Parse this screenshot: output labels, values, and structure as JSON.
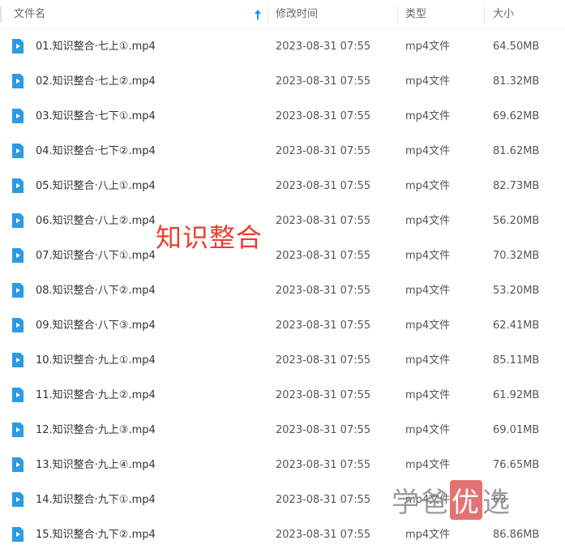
{
  "header": {
    "col_name": "文件名",
    "col_date": "修改时间",
    "col_type": "类型",
    "col_size": "大小"
  },
  "colors": {
    "accent": "#1e90ff",
    "file_icon": "#2b9be6",
    "overlay": "#e8402e",
    "watermark_highlight": "#e05a5a"
  },
  "files": [
    {
      "name": "01.知识整合·七上①.mp4",
      "date": "2023-08-31 07:55",
      "type": "mp4文件",
      "size": "64.50MB"
    },
    {
      "name": "02.知识整合·七上②.mp4",
      "date": "2023-08-31 07:55",
      "type": "mp4文件",
      "size": "81.32MB"
    },
    {
      "name": "03.知识整合·七下①.mp4",
      "date": "2023-08-31 07:55",
      "type": "mp4文件",
      "size": "69.62MB"
    },
    {
      "name": "04.知识整合·七下②.mp4",
      "date": "2023-08-31 07:55",
      "type": "mp4文件",
      "size": "81.62MB"
    },
    {
      "name": "05.知识整合·八上①.mp4",
      "date": "2023-08-31 07:55",
      "type": "mp4文件",
      "size": "82.73MB"
    },
    {
      "name": "06.知识整合·八上②.mp4",
      "date": "2023-08-31 07:55",
      "type": "mp4文件",
      "size": "56.20MB"
    },
    {
      "name": "07.知识整合·八下①.mp4",
      "date": "2023-08-31 07:55",
      "type": "mp4文件",
      "size": "70.32MB"
    },
    {
      "name": "08.知识整合·八下②.mp4",
      "date": "2023-08-31 07:55",
      "type": "mp4文件",
      "size": "53.20MB"
    },
    {
      "name": "09.知识整合·八下③.mp4",
      "date": "2023-08-31 07:55",
      "type": "mp4文件",
      "size": "62.41MB"
    },
    {
      "name": "10.知识整合·九上①.mp4",
      "date": "2023-08-31 07:55",
      "type": "mp4文件",
      "size": "85.11MB"
    },
    {
      "name": "11.知识整合·九上②.mp4",
      "date": "2023-08-31 07:55",
      "type": "mp4文件",
      "size": "61.92MB"
    },
    {
      "name": "12.知识整合·九上③.mp4",
      "date": "2023-08-31 07:55",
      "type": "mp4文件",
      "size": "69.01MB"
    },
    {
      "name": "13.知识整合·九上④.mp4",
      "date": "2023-08-31 07:55",
      "type": "mp4文件",
      "size": "76.65MB"
    },
    {
      "name": "14.知识整合·九下①.mp4",
      "date": "2023-08-31 07:55",
      "type": "mp4文件",
      "size": "63"
    },
    {
      "name": "15.知识整合·九下②.mp4",
      "date": "2023-08-31 07:55",
      "type": "mp4文件",
      "size": "86.86MB"
    }
  ],
  "overlay_title": "知识整合",
  "watermark": {
    "part1": "学爸",
    "part2": "优",
    "part3": "选"
  },
  "icons": {
    "file": "video-file-icon",
    "sort": "sort-ascending-icon"
  }
}
